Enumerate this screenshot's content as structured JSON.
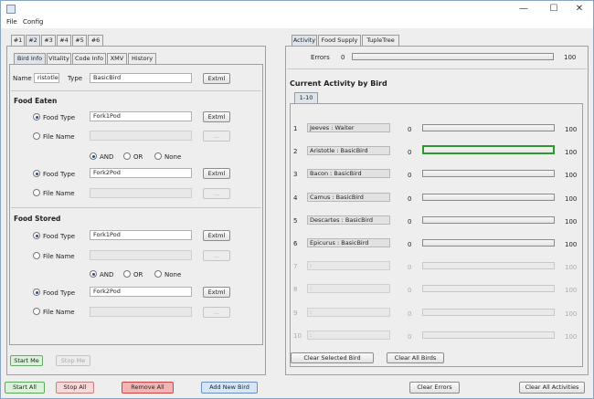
{
  "window": {
    "minimize": "—",
    "maximize": "☐",
    "close": "✕"
  },
  "menu": [
    "File",
    "Config"
  ],
  "bird_tabs": [
    "#1",
    "#2",
    "#3",
    "#4",
    "#5",
    "#6"
  ],
  "left_subtabs": [
    "Bird Info",
    "Vitality",
    "Code Info",
    "XMV",
    "History"
  ],
  "bird_info": {
    "name_label": "Name",
    "name_value": "ristotle",
    "type_label": "Type",
    "type_value": "BasicBird",
    "extml_label": "Extml"
  },
  "food_eaten": {
    "heading": "Food Eaten",
    "food_type_label": "Food Type",
    "file_name_label": "File Name",
    "food1": "Fork1Pod",
    "food2": "Fork2Pod",
    "browse_label": "...",
    "and_label": "AND",
    "or_label": "OR",
    "none_label": "None",
    "extml_label": "Extml"
  },
  "food_stored": {
    "heading": "Food Stored",
    "food_type_label": "Food Type",
    "file_name_label": "File Name",
    "food1": "Fork1Pod",
    "food2": "Fork2Pod",
    "browse_label": "...",
    "and_label": "AND",
    "or_label": "OR",
    "none_label": "None",
    "extml_label": "Extml"
  },
  "left_buttons": {
    "start_me": "Start Me",
    "stop_me": "Stop Me"
  },
  "right_tabs": [
    "Activity",
    "Food Supply",
    "TupleTree"
  ],
  "errors": {
    "label": "Errors",
    "value": "0",
    "max": "100",
    "progress": 0
  },
  "activity": {
    "heading": "Current Activity by Bird",
    "page_tab": "1-10",
    "rows": [
      {
        "index": "1",
        "bird": "Jeeves : Waiter",
        "value": "0",
        "max": "100",
        "progress": 0,
        "enabled": true,
        "selected": false
      },
      {
        "index": "2",
        "bird": "Aristotle : BasicBird",
        "value": "0",
        "max": "100",
        "progress": 0,
        "enabled": true,
        "selected": true
      },
      {
        "index": "3",
        "bird": "Bacon : BasicBird",
        "value": "0",
        "max": "100",
        "progress": 0,
        "enabled": true,
        "selected": false
      },
      {
        "index": "4",
        "bird": "Camus : BasicBird",
        "value": "0",
        "max": "100",
        "progress": 0,
        "enabled": true,
        "selected": false
      },
      {
        "index": "5",
        "bird": "Descartes : BasicBird",
        "value": "0",
        "max": "100",
        "progress": 0,
        "enabled": true,
        "selected": false
      },
      {
        "index": "6",
        "bird": "Epicurus : BasicBird",
        "value": "0",
        "max": "100",
        "progress": 0,
        "enabled": true,
        "selected": false
      },
      {
        "index": "7",
        "bird": ":",
        "value": "0",
        "max": "100",
        "progress": 0,
        "enabled": false,
        "selected": false
      },
      {
        "index": "8",
        "bird": ":",
        "value": "0",
        "max": "100",
        "progress": 0,
        "enabled": false,
        "selected": false
      },
      {
        "index": "9",
        "bird": ":",
        "value": "0",
        "max": "100",
        "progress": 0,
        "enabled": false,
        "selected": false
      },
      {
        "index": "10",
        "bird": ":",
        "value": "0",
        "max": "100",
        "progress": 0,
        "enabled": false,
        "selected": false
      }
    ],
    "clear_selected": "Clear Selected Bird",
    "clear_all_birds": "Clear All Birds"
  },
  "bottom_buttons": {
    "start_all": "Start All",
    "stop_all": "Stop All",
    "remove_all": "Remove All",
    "add_new_bird": "Add New Bird",
    "clear_errors": "Clear Errors",
    "clear_all_activities": "Clear All Activities"
  },
  "colors": {
    "start_green": "#d9f2d9",
    "stop_red": "#f8d8d8",
    "remove_red": "#f4b4b4",
    "add_blue": "#d4e6f8",
    "selected_bar": "#2e9a2e"
  }
}
